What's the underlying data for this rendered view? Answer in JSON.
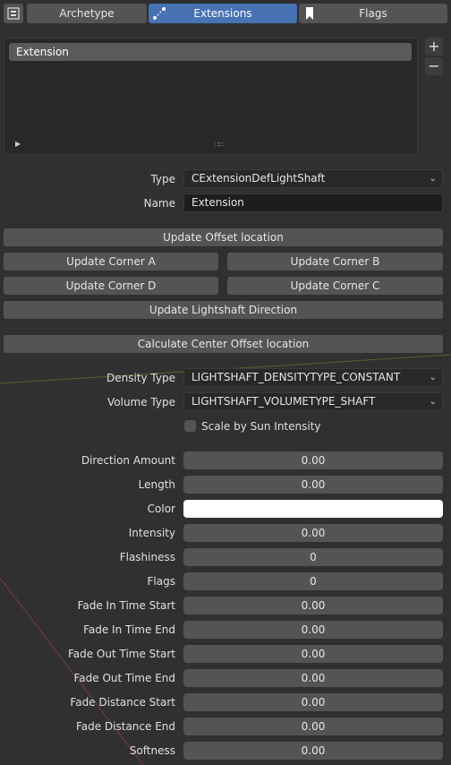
{
  "tabs": [
    {
      "label": "Archetype",
      "active": false
    },
    {
      "label": "Extensions",
      "active": true
    },
    {
      "label": "Flags",
      "active": false
    }
  ],
  "extension_list": {
    "items": [
      "Extension"
    ],
    "add_label": "+",
    "remove_label": "−",
    "expand_icon": "triangle-right-icon",
    "grip_icon": "grip-dots-icon"
  },
  "fields": {
    "type": {
      "label": "Type",
      "value": "CExtensionDefLightShaft"
    },
    "name": {
      "label": "Name",
      "value": "Extension"
    }
  },
  "buttons": {
    "update_offset": "Update Offset location",
    "corner_a": "Update Corner A",
    "corner_b": "Update Corner B",
    "corner_d": "Update Corner D",
    "corner_c": "Update Corner C",
    "lightshaft_dir": "Update Lightshaft Direction",
    "center_offset": "Calculate Center Offset location"
  },
  "density": {
    "label": "Density Type",
    "value": "LIGHTSHAFT_DENSITYTYPE_CONSTANT"
  },
  "volume": {
    "label": "Volume Type",
    "value": "LIGHTSHAFT_VOLUMETYPE_SHAFT"
  },
  "scale_by_sun": {
    "label": "Scale by Sun Intensity",
    "checked": false
  },
  "properties": {
    "direction_amount": {
      "label": "Direction Amount",
      "value": "0.00"
    },
    "length": {
      "label": "Length",
      "value": "0.00"
    },
    "color": {
      "label": "Color",
      "value": "#ffffff"
    },
    "intensity": {
      "label": "Intensity",
      "value": "0.00"
    },
    "flashiness": {
      "label": "Flashiness",
      "value": "0"
    },
    "flags": {
      "label": "Flags",
      "value": "0"
    },
    "fade_in_start": {
      "label": "Fade In Time Start",
      "value": "0.00"
    },
    "fade_in_end": {
      "label": "Fade In Time End",
      "value": "0.00"
    },
    "fade_out_start": {
      "label": "Fade Out Time Start",
      "value": "0.00"
    },
    "fade_out_end": {
      "label": "Fade Out Time End",
      "value": "0.00"
    },
    "fade_dist_start": {
      "label": "Fade Distance Start",
      "value": "0.00"
    },
    "fade_dist_end": {
      "label": "Fade Distance End",
      "value": "0.00"
    },
    "softness": {
      "label": "Softness",
      "value": "0.00"
    }
  },
  "colors": {
    "panel_bg": "#303030",
    "button": "#545454",
    "accent": "#4772b3",
    "field_dark": "#1d1d1d"
  }
}
